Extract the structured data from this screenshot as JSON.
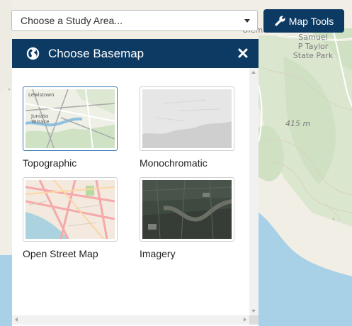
{
  "study_area": {
    "placeholder": "Choose a Study Area..."
  },
  "tools": {
    "label": "Map Tools",
    "icon": "wrench-icon"
  },
  "panel": {
    "title": "Choose Basemap",
    "icon": "globe-icon",
    "close_icon": "close-icon",
    "basemaps": [
      {
        "label": "Topographic",
        "selected": true
      },
      {
        "label": "Monochromatic",
        "selected": false
      },
      {
        "label": "Open Street Map",
        "selected": false
      },
      {
        "label": "Imagery",
        "selected": false
      }
    ]
  },
  "map_labels": {
    "place_1": "Olema",
    "park_line1": "Samuel",
    "park_line2": "P Taylor",
    "park_line3": "State Park",
    "elevation": "415 m"
  },
  "colors": {
    "header": "#0d3a63",
    "button": "#0d3a63",
    "water": "#a8d1e8",
    "land": "#f2efe6",
    "forest": "#cfe0c3",
    "selected_border": "#3a78b5"
  }
}
